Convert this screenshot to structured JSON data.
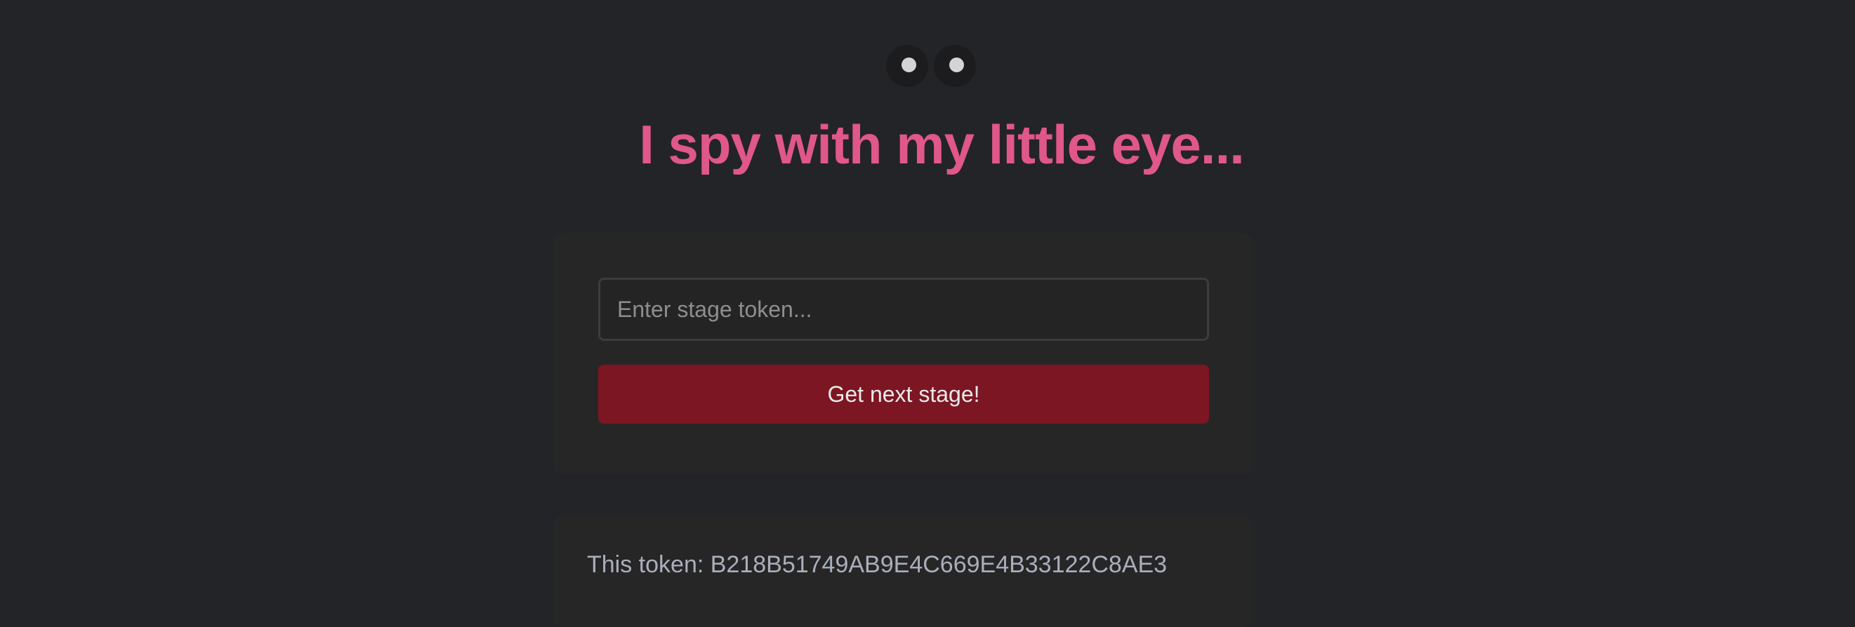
{
  "header": {
    "title": "I spy with my little eye...",
    "eyes_icon": "eyes-icon"
  },
  "form": {
    "token_placeholder": "Enter stage token...",
    "token_value": "",
    "submit_label": "Get next stage!"
  },
  "info": {
    "token_prefix": "This token: ",
    "token_value": "B218B51749AB9E4C669E4B33122C8AE3"
  },
  "colors": {
    "background": "#232427",
    "title": "#e0578a",
    "button": "#7c1622",
    "panel": "#262627",
    "token_text": "#a9afbb"
  }
}
